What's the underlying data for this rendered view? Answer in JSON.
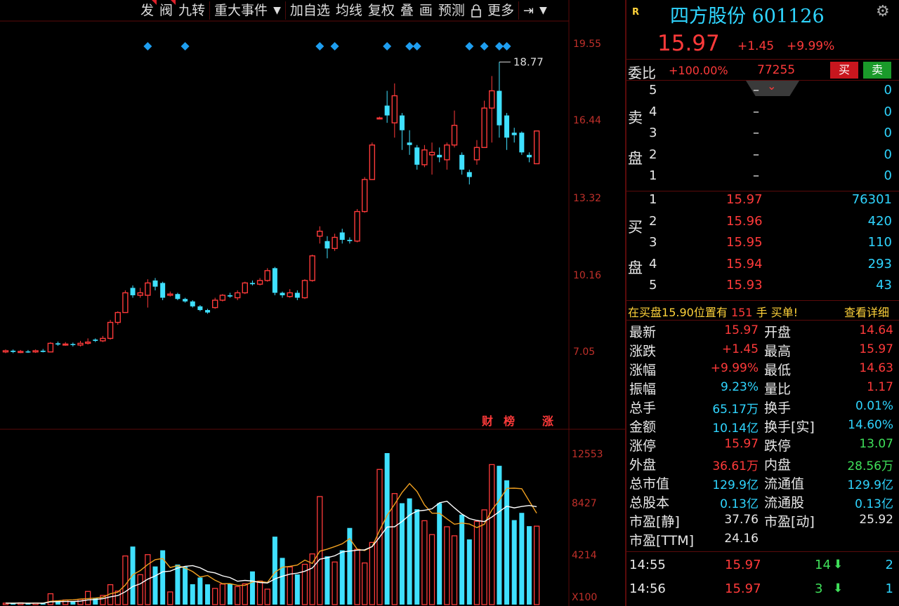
{
  "toolbar": {
    "items": [
      "发",
      "阀",
      "九转",
      "重大事件",
      "加自选",
      "均线",
      "复权",
      "叠",
      "画",
      "预测",
      "锁",
      "更多"
    ]
  },
  "price_axis": [
    "19.55",
    "16.44",
    "13.32",
    "10.16",
    "7.05"
  ],
  "volume_axis": [
    "12553",
    "8427",
    "4214",
    "X100"
  ],
  "high_marker": "18.77",
  "event_labels": [
    "财",
    "榜",
    "涨"
  ],
  "colors": {
    "up": "#ff3a3a",
    "down": "#3fe0ff",
    "ma5": "#f0a020",
    "ma10": "#ffffff",
    "grid": "#5a0a0a"
  },
  "chart_data": {
    "type": "candlestick",
    "candles": [
      {
        "o": 7.0,
        "c": 7.05,
        "h": 7.1,
        "l": 6.95
      },
      {
        "o": 7.05,
        "c": 7.0,
        "h": 7.1,
        "l": 6.95
      },
      {
        "o": 7.0,
        "c": 7.02,
        "h": 7.08,
        "l": 6.95
      },
      {
        "o": 7.02,
        "c": 7.0,
        "h": 7.08,
        "l": 6.96
      },
      {
        "o": 7.0,
        "c": 7.05,
        "h": 7.1,
        "l": 6.96
      },
      {
        "o": 7.05,
        "c": 7.0,
        "h": 7.12,
        "l": 6.98
      },
      {
        "o": 7.0,
        "c": 7.35,
        "h": 7.4,
        "l": 6.98
      },
      {
        "o": 7.35,
        "c": 7.3,
        "h": 7.42,
        "l": 7.25
      },
      {
        "o": 7.3,
        "c": 7.32,
        "h": 7.4,
        "l": 7.25
      },
      {
        "o": 7.32,
        "c": 7.28,
        "h": 7.38,
        "l": 7.22
      },
      {
        "o": 7.28,
        "c": 7.35,
        "h": 7.45,
        "l": 7.22
      },
      {
        "o": 7.35,
        "c": 7.4,
        "h": 7.55,
        "l": 7.3
      },
      {
        "o": 7.5,
        "c": 7.45,
        "h": 7.55,
        "l": 7.4
      },
      {
        "o": 7.45,
        "c": 7.55,
        "h": 7.65,
        "l": 7.4
      },
      {
        "o": 7.55,
        "c": 8.2,
        "h": 8.3,
        "l": 7.5
      },
      {
        "o": 8.2,
        "c": 8.6,
        "h": 8.65,
        "l": 8.1
      },
      {
        "o": 8.6,
        "c": 9.4,
        "h": 9.5,
        "l": 8.6
      },
      {
        "o": 9.6,
        "c": 9.3,
        "h": 9.7,
        "l": 9.2
      },
      {
        "o": 9.3,
        "c": 9.4,
        "h": 9.6,
        "l": 9.2
      },
      {
        "o": 9.3,
        "c": 9.8,
        "h": 9.95,
        "l": 8.8
      },
      {
        "o": 9.9,
        "c": 9.65,
        "h": 10.0,
        "l": 9.5
      },
      {
        "o": 9.8,
        "c": 9.2,
        "h": 9.85,
        "l": 9.1
      },
      {
        "o": 9.3,
        "c": 9.35,
        "h": 9.45,
        "l": 9.25
      },
      {
        "o": 9.35,
        "c": 9.15,
        "h": 9.4,
        "l": 9.1
      },
      {
        "o": 9.15,
        "c": 9.05,
        "h": 9.2,
        "l": 9.0
      },
      {
        "o": 9.05,
        "c": 8.85,
        "h": 9.1,
        "l": 8.8
      },
      {
        "o": 8.85,
        "c": 8.7,
        "h": 8.9,
        "l": 8.65
      },
      {
        "o": 8.7,
        "c": 8.6,
        "h": 8.75,
        "l": 8.55
      },
      {
        "o": 8.8,
        "c": 9.1,
        "h": 9.2,
        "l": 8.75
      },
      {
        "o": 9.1,
        "c": 9.3,
        "h": 9.35,
        "l": 9.05
      },
      {
        "o": 9.3,
        "c": 9.25,
        "h": 9.4,
        "l": 9.2
      },
      {
        "o": 9.2,
        "c": 9.4,
        "h": 9.5,
        "l": 9.1
      },
      {
        "o": 9.4,
        "c": 9.8,
        "h": 9.85,
        "l": 9.35
      },
      {
        "o": 9.8,
        "c": 9.75,
        "h": 9.9,
        "l": 9.7
      },
      {
        "o": 9.75,
        "c": 9.9,
        "h": 10.0,
        "l": 9.7
      },
      {
        "o": 9.9,
        "c": 10.3,
        "h": 10.4,
        "l": 9.85
      },
      {
        "o": 10.4,
        "c": 9.4,
        "h": 10.45,
        "l": 9.3
      },
      {
        "o": 9.4,
        "c": 9.3,
        "h": 9.45,
        "l": 9.2
      },
      {
        "o": 9.25,
        "c": 9.4,
        "h": 9.55,
        "l": 9.2
      },
      {
        "o": 9.4,
        "c": 9.2,
        "h": 9.5,
        "l": 9.1
      },
      {
        "o": 9.2,
        "c": 9.9,
        "h": 9.95,
        "l": 9.15
      },
      {
        "o": 9.9,
        "c": 10.9,
        "h": 10.95,
        "l": 9.85
      },
      {
        "o": 11.7,
        "c": 11.9,
        "h": 12.1,
        "l": 11.4
      },
      {
        "o": 11.5,
        "c": 11.2,
        "h": 11.7,
        "l": 10.8
      },
      {
        "o": 11.2,
        "c": 11.65,
        "h": 11.8,
        "l": 11.1
      },
      {
        "o": 11.85,
        "c": 11.55,
        "h": 12.0,
        "l": 11.4
      },
      {
        "o": 11.55,
        "c": 11.5,
        "h": 11.65,
        "l": 11.4
      },
      {
        "o": 11.5,
        "c": 12.7,
        "h": 12.8,
        "l": 11.45
      },
      {
        "o": 12.7,
        "c": 14.0,
        "h": 14.1,
        "l": 12.65
      },
      {
        "o": 14.0,
        "c": 15.4,
        "h": 15.5,
        "l": 14.0
      },
      {
        "o": 16.5,
        "c": 16.5,
        "h": 16.55,
        "l": 16.45
      },
      {
        "o": 17.0,
        "c": 16.6,
        "h": 17.6,
        "l": 16.3
      },
      {
        "o": 16.3,
        "c": 17.4,
        "h": 17.9,
        "l": 15.7
      },
      {
        "o": 16.6,
        "c": 16.0,
        "h": 16.7,
        "l": 15.2
      },
      {
        "o": 15.5,
        "c": 15.4,
        "h": 16.0,
        "l": 15.0
      },
      {
        "o": 15.3,
        "c": 14.6,
        "h": 15.4,
        "l": 14.4
      },
      {
        "o": 14.6,
        "c": 15.2,
        "h": 15.4,
        "l": 14.5
      },
      {
        "o": 15.0,
        "c": 15.1,
        "h": 15.5,
        "l": 14.2
      },
      {
        "o": 15.0,
        "c": 14.9,
        "h": 15.3,
        "l": 14.7
      },
      {
        "o": 14.8,
        "c": 15.4,
        "h": 15.5,
        "l": 14.4
      },
      {
        "o": 15.4,
        "c": 16.2,
        "h": 16.8,
        "l": 15.3
      },
      {
        "o": 15.0,
        "c": 14.4,
        "h": 15.1,
        "l": 14.2
      },
      {
        "o": 14.3,
        "c": 14.1,
        "h": 14.4,
        "l": 13.8
      },
      {
        "o": 14.8,
        "c": 15.3,
        "h": 15.6,
        "l": 14.6
      },
      {
        "o": 15.3,
        "c": 16.9,
        "h": 17.2,
        "l": 15.3
      },
      {
        "o": 16.9,
        "c": 17.6,
        "h": 18.2,
        "l": 15.5
      },
      {
        "o": 17.6,
        "c": 16.2,
        "h": 18.77,
        "l": 15.7
      },
      {
        "o": 16.6,
        "c": 15.7,
        "h": 16.7,
        "l": 15.2
      },
      {
        "o": 15.9,
        "c": 15.8,
        "h": 16.1,
        "l": 15.5
      },
      {
        "o": 15.9,
        "c": 15.1,
        "h": 15.95,
        "l": 15.0
      },
      {
        "o": 15.0,
        "c": 14.9,
        "h": 15.1,
        "l": 14.7
      },
      {
        "o": 14.64,
        "c": 15.97,
        "h": 15.97,
        "l": 14.63
      }
    ],
    "volumes": [
      120,
      110,
      150,
      90,
      130,
      100,
      900,
      340,
      380,
      260,
      430,
      1090,
      550,
      760,
      1650,
      1120,
      4030,
      4810,
      2480,
      4140,
      3160,
      4500,
      1050,
      3320,
      3130,
      1690,
      2240,
      1680,
      1340,
      1700,
      1740,
      1490,
      1720,
      2750,
      1950,
      1280,
      5630,
      3870,
      3120,
      2500,
      3340,
      4200,
      8950,
      4000,
      3530,
      4500,
      6350,
      4580,
      3450,
      5150,
      11200,
      12553,
      9200,
      8400,
      8800,
      7900,
      6950,
      5800,
      8400,
      6450,
      5700,
      7450,
      5400,
      6900,
      7850,
      11600,
      11500,
      10300,
      7000,
      7600,
      6500,
      6500
    ]
  },
  "panel": {
    "r_badge": "R",
    "stock_title": "四方股份 601126",
    "price": "15.97",
    "change": "+1.45",
    "change_pct": "+9.99%",
    "weibi_label": "委比",
    "weibi_value": "+100.00%",
    "weibi_vol": "77255",
    "buy_btn": "买",
    "sell_btn": "卖",
    "sell_label_1": "卖",
    "sell_label_2": "盘",
    "buy_label_1": "买",
    "buy_label_2": "盘",
    "asks": [
      {
        "n": "5",
        "p": "–",
        "v": "0"
      },
      {
        "n": "4",
        "p": "–",
        "v": "0"
      },
      {
        "n": "3",
        "p": "–",
        "v": "0"
      },
      {
        "n": "2",
        "p": "–",
        "v": "0"
      },
      {
        "n": "1",
        "p": "–",
        "v": "0"
      }
    ],
    "bids": [
      {
        "n": "1",
        "p": "15.97",
        "v": "76301"
      },
      {
        "n": "2",
        "p": "15.96",
        "v": "420"
      },
      {
        "n": "3",
        "p": "15.95",
        "v": "110"
      },
      {
        "n": "4",
        "p": "15.94",
        "v": "293"
      },
      {
        "n": "5",
        "p": "15.93",
        "v": "43"
      }
    ],
    "notice_prefix": "在买盘",
    "notice_price": "15.90",
    "notice_mid": "位置有",
    "notice_qty": "151",
    "notice_suffix": "手 买单!",
    "notice_link": "查看详细",
    "stats": [
      {
        "l": "最新",
        "v": "15.97",
        "vc": "red",
        "l2": "开盘",
        "v2": "14.64",
        "v2c": "red"
      },
      {
        "l": "涨跌",
        "v": "+1.45",
        "vc": "red",
        "l2": "最高",
        "v2": "15.97",
        "v2c": "red"
      },
      {
        "l": "涨幅",
        "v": "+9.99%",
        "vc": "red",
        "l2": "最低",
        "v2": "14.63",
        "v2c": "red"
      },
      {
        "l": "振幅",
        "v": "9.23%",
        "vc": "cyan",
        "l2": "量比",
        "v2": "1.17",
        "v2c": "red"
      },
      {
        "l": "总手",
        "v": "65.17万",
        "vc": "cyan",
        "l2": "换手",
        "v2": "0.01%",
        "v2c": "cyan"
      },
      {
        "l": "金额",
        "v": "10.14亿",
        "vc": "cyan",
        "l2": "换手[实]",
        "v2": "14.60%",
        "v2c": "cyan"
      },
      {
        "l": "涨停",
        "v": "15.97",
        "vc": "red",
        "l2": "跌停",
        "v2": "13.07",
        "v2c": "green"
      },
      {
        "l": "外盘",
        "v": "36.61万",
        "vc": "red",
        "l2": "内盘",
        "v2": "28.56万",
        "v2c": "green"
      },
      {
        "l": "总市值",
        "v": "129.9亿",
        "vc": "cyan",
        "l2": "流通值",
        "v2": "129.9亿",
        "v2c": "cyan"
      },
      {
        "l": "总股本",
        "v": "0.13亿",
        "vc": "cyan",
        "l2": "流通股",
        "v2": "0.13亿",
        "v2c": "cyan"
      },
      {
        "l": "市盈[静]",
        "v": "37.76",
        "vc": "white",
        "l2": "市盈[动]",
        "v2": "25.92",
        "v2c": "white"
      },
      {
        "l": "市盈[TTM]",
        "v": "24.16",
        "vc": "white",
        "l2": "",
        "v2": "",
        "v2c": "white"
      }
    ],
    "ticks": [
      {
        "t": "14:55",
        "p": "15.97",
        "q": "14",
        "n": "2"
      },
      {
        "t": "14:56",
        "p": "15.97",
        "q": "3",
        "n": "1"
      }
    ]
  }
}
